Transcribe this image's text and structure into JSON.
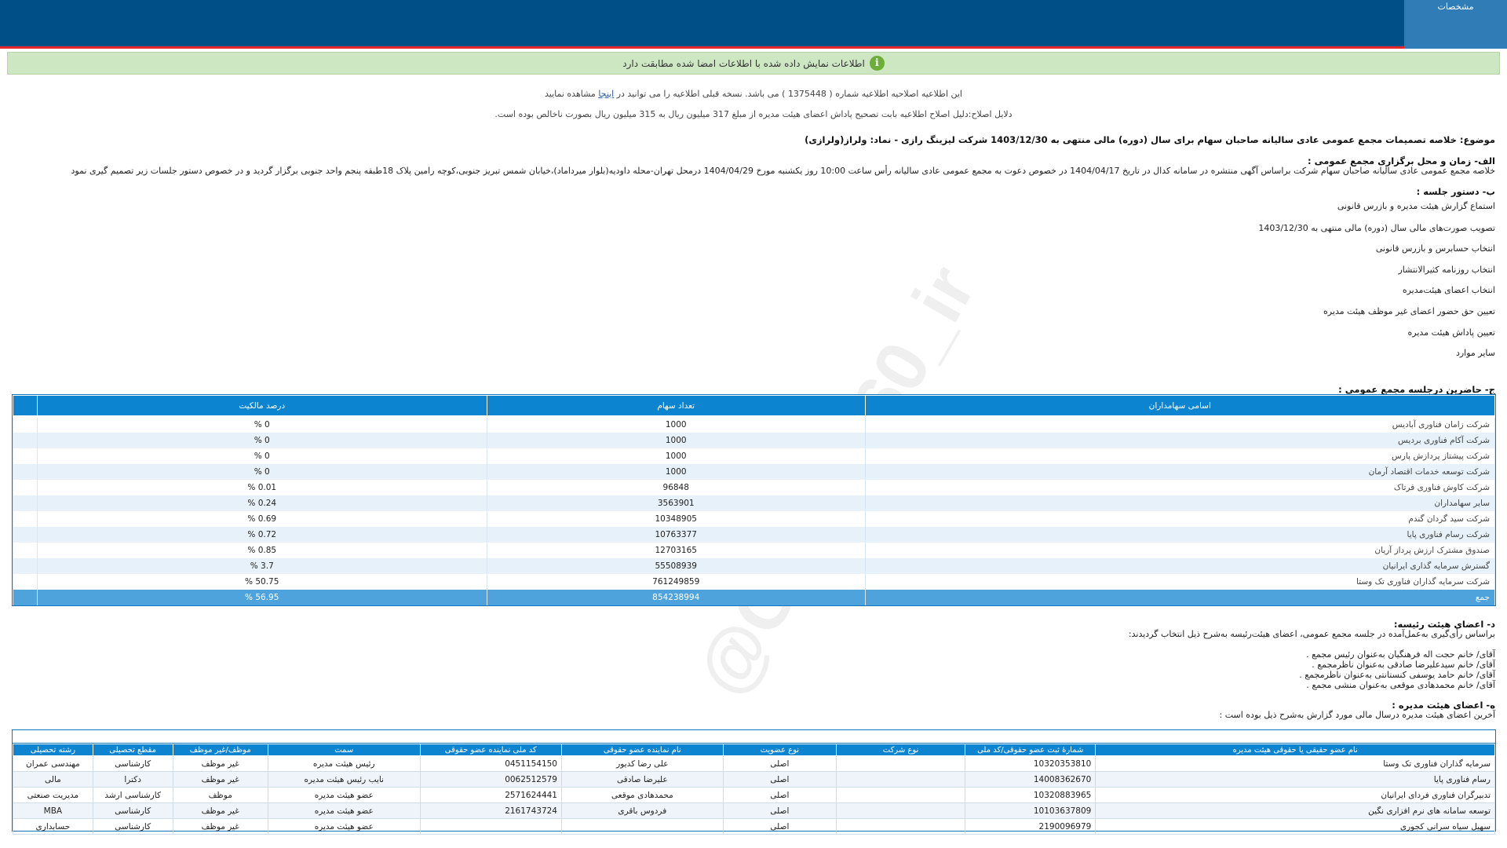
{
  "header": {
    "tab_label": "مشخصات"
  },
  "banner": {
    "text": "اطلاعات نمایش داده شده با اطلاعات امضا شده مطابقت دارد",
    "icon": "info-icon",
    "icon_color": "#6cae38"
  },
  "correction": {
    "notice_before": "این اطلاعیه اصلاحیه اطلاعیه شماره ( 1375448 ) می باشد. نسخه قبلی اطلاعیه را می توانید در ",
    "notice_link": "اینجا",
    "notice_after": " مشاهده نمایید",
    "reason": "دلایل اصلاح:دلیل اصلاح اطلاعیه بابت تصحیح پاداش اعضای هیئت مدیره از مبلغ 317 میلیون ریال به 315 میلیون ریال بصورت ناخالص بوده است."
  },
  "subject": "موضوع: خلاصه تصمیمات مجمع عمومی عادی سالیانه صاحبان سهام برای سال (دوره) مالی منتهی به 1403/12/30 شرکت لیزینگ رازی - نماد: ولراز(ولرازی)",
  "section_a": {
    "title": "الف- زمان و محل برگزاری مجمع عمومی :",
    "text": "خلاصه مجمع عمومی عادی سالیانه صاحبان سهام شرکت براساس آگهی منتشره در سامانه کدال در تاریخ 1404/04/17 در خصوص دعوت به مجمع عمومی عادی سالیانه رأس ساعت 10:00 روز یکشنبه مورخ 1404/04/29 درمحل تهران-محله داودیه(بلوار میرداماد)،خیابان شمس تبریز جنوبی،کوچه رامین پلاک 18طبقه پنجم واحد جنوبی برگزار گردید و در خصوص دستور جلسات زیر تصمیم گیری نمود"
  },
  "section_b": {
    "title": "ب- دستور جلسه :",
    "items": [
      "استماع گزارش هیئت مدیره و بازرس قانونی",
      "تصویب صورت‌های مالی سال (دوره) مالی منتهی به 1403/12/30",
      "انتخاب حسابرس و بازرس قانونی",
      "انتخاب روزنامه کثیرالانتشار",
      "انتخاب اعضای هیئت‌مدیره",
      "تعیین حق حضور اعضای غیر موظف هیئت مدیره",
      "تعیین پاداش هیئت مدیره",
      "سایر موارد"
    ]
  },
  "section_c": {
    "title": "ج- حاضرین درجلسه مجمع عمومی :",
    "columns": [
      "اسامی سهامداران",
      "تعداد سهام",
      "درصد مالکیت"
    ],
    "rows": [
      [
        "شرکت زامان فناوری آبادیس",
        "1000",
        "0 %"
      ],
      [
        "شرکت آکام فناوری بردیس",
        "1000",
        "0 %"
      ],
      [
        "شرکت پیشتاز پردازش پارس",
        "1000",
        "0 %"
      ],
      [
        "شرکت توسعه خدمات اقتصاد آرمان",
        "1000",
        "0 %"
      ],
      [
        "شرکت کاوش فناوری فرتاک",
        "96848",
        "0.01 %"
      ],
      [
        "سایر سهامداران",
        "3563901",
        "0.24 %"
      ],
      [
        "شرکت سید گردان گندم",
        "10348905",
        "0.69 %"
      ],
      [
        "شرکت رسام فناوری پایا",
        "10763377",
        "0.72 %"
      ],
      [
        "صندوق مشترک ارزش پرداز آریان",
        "12703165",
        "0.85 %"
      ],
      [
        "گسترش سرمایه گذاری ایرانیان",
        "55508939",
        "3.7 %"
      ],
      [
        "شرکت سرمایه گذاران فناوری تک وستا",
        "761249859",
        "50.75 %"
      ]
    ],
    "total": [
      "جمع",
      "854238994",
      "56.95 %"
    ]
  },
  "section_d": {
    "title": "د- اعضای هیئت رئیسه:",
    "intro": "براساس رأی‌گیری به‌عمل‌آمده در جلسه مجمع عمومی، اعضای هیئت‌رئیسه به‌شرح ذیل انتخاب گردیدند:",
    "members": [
      "آقای/ خانم حجت اله فرهنگیان به‌عنوان رئیس مجمع .",
      "آقای/ خانم سیدعلیرضا صادقی به‌عنوان ناظرمجمع .",
      "آقای/ خانم حامد یوسفی کنستانتی به‌عنوان ناظرمجمع .",
      "آقای/ خانم محمدهادی موقعی به‌عنوان منشی مجمع ."
    ]
  },
  "section_e": {
    "title": "ه- اعضای هیئت مدیره :",
    "intro": "آخرین اعضای هیئت مدیره درسال مالی مورد گزارش به‌شرح ذیل بوده است :",
    "columns": [
      "نام عضو حقیقی یا حقوقی هیئت مدیره",
      "شمارهٔ ثبت عضو حقوقی/کد ملی",
      "نوع شرکت",
      "نوع عضویت",
      "نام نماینده عضو حقوقی",
      "کد ملی نماینده عضو حقوقی",
      "سمت",
      "موظف/غیر موظف",
      "مقطع تحصیلی",
      "رشته تحصیلی"
    ],
    "rows": [
      [
        "سرمایه گذاران فناوری تک وستا",
        "10320353810",
        "",
        "اصلی",
        "علی رضا کدیور",
        "0451154150",
        "رئیس هیئت مدیره",
        "غیر موظف",
        "کارشناسی",
        "مهندسی عمران"
      ],
      [
        "رسام فناوری پایا",
        "14008362670",
        "",
        "اصلی",
        "علیرضا صادقی",
        "0062512579",
        "نایب رئیس هیئت مدیره",
        "غیر موظف",
        "دکترا",
        "مالی"
      ],
      [
        "تدبیرگران فناوری فردای ایرانیان",
        "10320883965",
        "",
        "اصلی",
        "محمدهادی موقعی",
        "2571624441",
        "عضو هیئت مدیره",
        "موظف",
        "کارشناسی ارشد",
        "مدیریت صنعتی"
      ],
      [
        "توسعه سامانه های نرم افزاری نگین",
        "10103637809",
        "",
        "اصلی",
        "فردوس باقری",
        "2161743724",
        "عضو هیئت مدیره",
        "غیر موظف",
        "کارشناسی",
        "MBA"
      ],
      [
        "سهیل سیاه سرانی کجوری",
        "2190096979",
        "",
        "اصلی",
        "",
        "",
        "عضو هیئت مدیره",
        "غیر موظف",
        "کارشناسی",
        "حسابداری"
      ]
    ]
  },
  "watermark": "@Codal360_ir",
  "colors": {
    "header": "#004f86",
    "header_border": "#e5262c",
    "table_header": "#0c84cf",
    "banner": "#cde7c3"
  }
}
